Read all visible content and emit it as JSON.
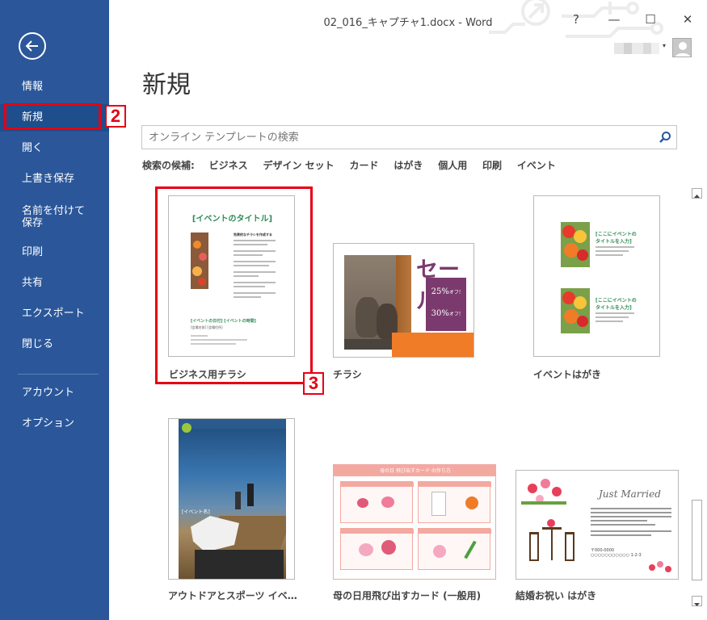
{
  "window": {
    "title": "02_016_キャプチャ1.docx - Word",
    "help": "?",
    "minimize": "—",
    "maximize": "☐",
    "close": "✕"
  },
  "sidebar": {
    "items": [
      {
        "label": "情報"
      },
      {
        "label": "新規",
        "active": true
      },
      {
        "label": "開く"
      },
      {
        "label": "上書き保存"
      },
      {
        "label": "名前を付けて"
      },
      {
        "label": "印刷"
      },
      {
        "label": "共有"
      },
      {
        "label": "エクスポート"
      },
      {
        "label": "閉じる"
      },
      {
        "label": "アカウント"
      },
      {
        "label": "オプション"
      }
    ],
    "save_as_line2": "保存"
  },
  "main": {
    "title": "新規",
    "search": {
      "placeholder": "オンライン テンプレートの検索"
    },
    "suggestions_label": "検索の候補:",
    "suggestions": [
      "ビジネス",
      "デザイン セット",
      "カード",
      "はがき",
      "個人用",
      "印刷",
      "イベント"
    ],
    "templates": [
      {
        "label": "ビジネス用チラシ"
      },
      {
        "label": "チラシ"
      },
      {
        "label": "イベントはがき"
      },
      {
        "label": "アウトドアとスポーツ イベ…"
      },
      {
        "label": "母の日用飛び出すカード (一般用)"
      },
      {
        "label": "結婚お祝い はがき"
      }
    ]
  },
  "thumbs": {
    "flyer_title": "[イベントのタイトル]",
    "flyer_heading": "効果的なチラシを作成する",
    "flyer_date": "[イベントの日付] [イベントの時間]",
    "flyer_venue": "[会場名前] [会場住所]",
    "sale_title": "セール!",
    "sale_pct1": "25%",
    "sale_pct2": "30%",
    "sale_off": "オフ!",
    "postcard_heading1": "[ここにイベントの",
    "postcard_heading2": "タイトルを入力]",
    "outdoor_tag": "[イベント名]",
    "mother_header": "母の日 飛び出すカード の作り方",
    "just_married": "Just Married",
    "wedding_phone": "〒000-0000",
    "wedding_addr": "○○○○○○○○○○○ 1-2-3"
  },
  "annotations": {
    "step2": "2",
    "step3": "3"
  },
  "colors": {
    "sidebar": "#2b579a",
    "sidebar_active": "#1e4e8c",
    "annotation_red": "#e60012",
    "flyer_green": "#2e8b57",
    "sale_purple": "#7b3a6e",
    "sale_orange": "#f07c28"
  }
}
